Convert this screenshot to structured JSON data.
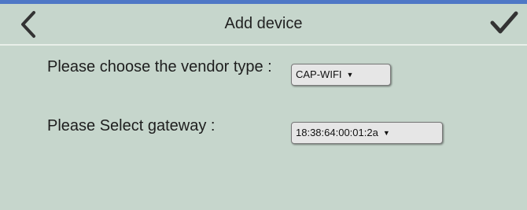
{
  "header": {
    "title": "Add device",
    "back_icon": "chevron-left-icon",
    "confirm_icon": "checkmark-icon"
  },
  "form": {
    "vendor_label": "Please choose the vendor type :",
    "vendor_value": "CAP-WIFI",
    "gateway_label": "Please Select gateway :",
    "gateway_value": "18:38:64:00:01:2a"
  },
  "colors": {
    "background": "#c6d6cc",
    "accent_bar": "#4f78c6"
  }
}
